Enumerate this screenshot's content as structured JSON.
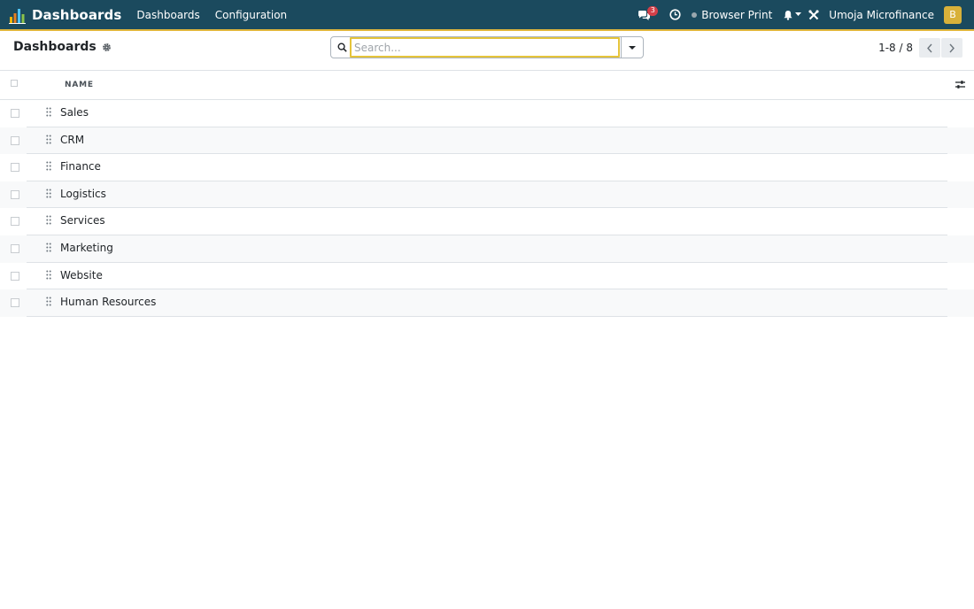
{
  "navbar": {
    "app_name": "Dashboards",
    "menu": [
      "Dashboards",
      "Configuration"
    ],
    "messages_count": "3",
    "print_label": "Browser Print",
    "company": "Umoja Microfinance",
    "avatar_letter": "B",
    "bg_color": "#1b4a5e",
    "accent_color": "#e0b63c"
  },
  "control_panel": {
    "title": "Dashboards",
    "search_placeholder": "Search...",
    "pager": "1-8 / 8"
  },
  "list": {
    "columns": [
      "NAME"
    ],
    "rows": [
      "Sales",
      "CRM",
      "Finance",
      "Logistics",
      "Services",
      "Marketing",
      "Website",
      "Human Resources"
    ]
  },
  "icons": {
    "brand": "bar-chart-icon",
    "messages": "chat-bubbles-icon",
    "activity": "clock-icon",
    "notifications": "bell-icon",
    "debug": "tools-icon",
    "settings": "gear-icon",
    "search": "search-icon",
    "pager_prev": "chevron-left-icon",
    "pager_next": "chevron-right-icon",
    "column_toggler": "sliders-icon",
    "row_handle": "drag-handle-icon"
  }
}
